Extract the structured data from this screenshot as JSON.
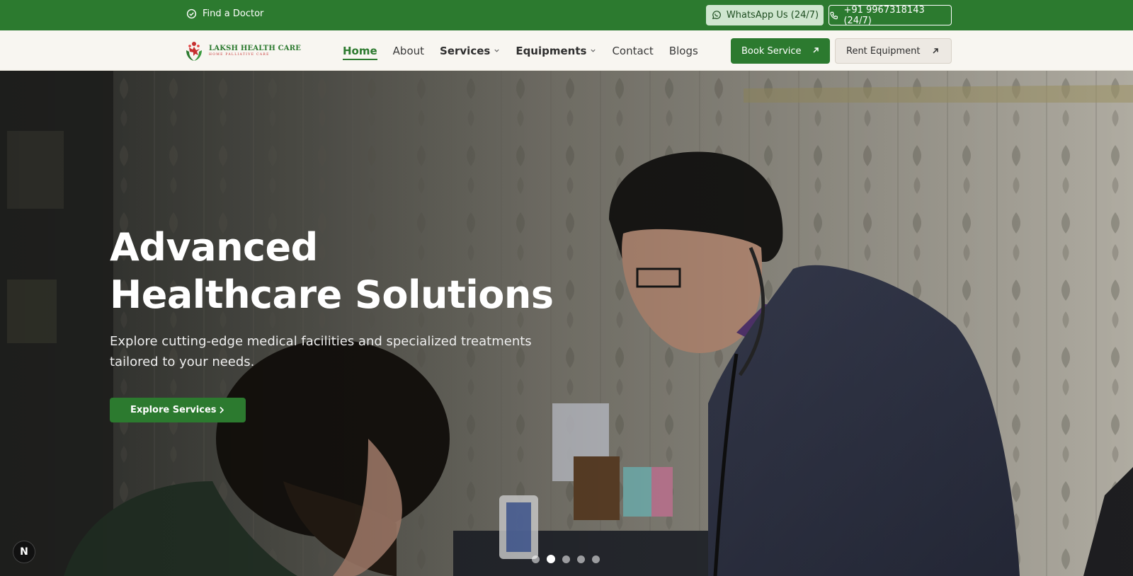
{
  "topbar": {
    "find_doctor": "Find a Doctor",
    "whatsapp": "WhatsApp Us (24/7)",
    "phone": "+91 9967318143 (24/7)"
  },
  "logo": {
    "title": "LAKSH HEALTH CARE",
    "subtitle": "HOME PALLIATIVE CARE"
  },
  "nav": {
    "items": [
      {
        "label": "Home",
        "active": true
      },
      {
        "label": "About"
      },
      {
        "label": "Services",
        "dropdown": true
      },
      {
        "label": "Equipments",
        "dropdown": true
      },
      {
        "label": "Contact"
      },
      {
        "label": "Blogs"
      }
    ],
    "book_service": "Book Service",
    "rent_equipment": "Rent Equipment"
  },
  "hero": {
    "title_line1": "Advanced",
    "title_line2": "Healthcare Solutions",
    "subtitle": "Explore cutting-edge medical facilities and specialized treatments tailored to your needs.",
    "cta": "Explore Services",
    "slides_count": 5,
    "active_slide": 2
  },
  "badge": "N",
  "colors": {
    "primary_green": "#2c7a2f",
    "nav_bg": "#f8f6f1",
    "accent_red": "#c53030"
  }
}
